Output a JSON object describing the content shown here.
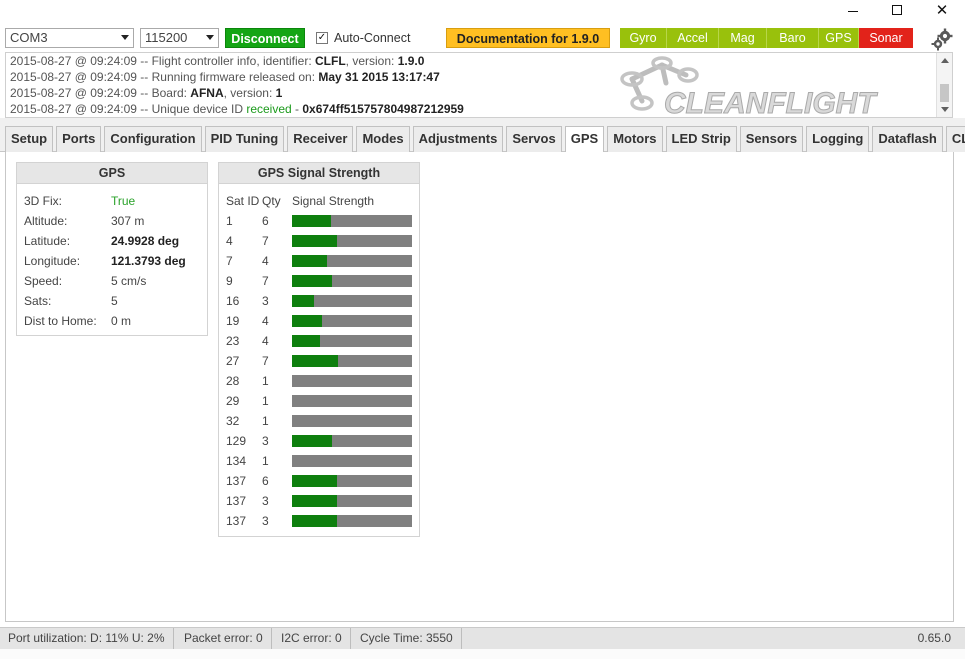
{
  "window": {
    "minimize_glyph": "—",
    "close_glyph": "✕"
  },
  "header": {
    "port": "COM3",
    "baud": "115200",
    "disconnect_label": "Disconnect",
    "auto_connect_label": "Auto-Connect",
    "auto_connect_checked": true,
    "documentation_label": "Documentation for 1.9.0",
    "sensors": [
      {
        "label": "Gyro",
        "state": "on"
      },
      {
        "label": "Accel",
        "state": "on"
      },
      {
        "label": "Mag",
        "state": "on"
      },
      {
        "label": "Baro",
        "state": "on"
      },
      {
        "label": "GPS",
        "state": "on"
      },
      {
        "label": "Sonar",
        "state": "off"
      }
    ],
    "settings_icon": "gear-icon"
  },
  "log": {
    "lines": [
      {
        "prefix": "2015-08-27 @ 09:24:09 -- Flight controller info, identifier: ",
        "b1": "CLFL",
        "mid": ", version: ",
        "b2": "1.9.0"
      },
      {
        "prefix": "2015-08-27 @ 09:24:09 -- Running firmware released on: ",
        "b1": "May 31 2015 13:17:47"
      },
      {
        "prefix": "2015-08-27 @ 09:24:09 -- Board: ",
        "b1": "AFNA",
        "mid": ", version: ",
        "b2": "1"
      },
      {
        "prefix": "2015-08-27 @ 09:24:09 -- Unique device ID ",
        "green": "received",
        "mid": " - ",
        "b2": "0x674ff515757804987212959"
      }
    ],
    "logo_text": "CLEANFLIGHT"
  },
  "tabs": [
    "Setup",
    "Ports",
    "Configuration",
    "PID Tuning",
    "Receiver",
    "Modes",
    "Adjustments",
    "Servos",
    "GPS",
    "Motors",
    "LED Strip",
    "Sensors",
    "Logging",
    "Dataflash",
    "CLI"
  ],
  "active_tab": "GPS",
  "gps": {
    "title": "GPS",
    "fields": [
      {
        "key": "3D Fix:",
        "value": "True",
        "style": "green"
      },
      {
        "key": "Altitude:",
        "value": "307 m",
        "style": ""
      },
      {
        "key": "Latitude:",
        "value": "24.9928 deg",
        "style": "bold"
      },
      {
        "key": "Longitude:",
        "value": "121.3793 deg",
        "style": "bold"
      },
      {
        "key": "Speed:",
        "value": "5 cm/s",
        "style": ""
      },
      {
        "key": "Sats:",
        "value": "5",
        "style": ""
      },
      {
        "key": "Dist to Home:",
        "value": "0 m",
        "style": ""
      }
    ]
  },
  "signal": {
    "title": "GPS Signal Strength",
    "col_sat": "Sat ID",
    "col_qty": "Qty",
    "col_strength": "Signal Strength",
    "rows": [
      {
        "sat": "1",
        "qty": "6",
        "strength": 32
      },
      {
        "sat": "4",
        "qty": "7",
        "strength": 37
      },
      {
        "sat": "7",
        "qty": "4",
        "strength": 29
      },
      {
        "sat": "9",
        "qty": "7",
        "strength": 33
      },
      {
        "sat": "16",
        "qty": "3",
        "strength": 18
      },
      {
        "sat": "19",
        "qty": "4",
        "strength": 25
      },
      {
        "sat": "23",
        "qty": "4",
        "strength": 23
      },
      {
        "sat": "27",
        "qty": "7",
        "strength": 38
      },
      {
        "sat": "28",
        "qty": "1",
        "strength": 0
      },
      {
        "sat": "29",
        "qty": "1",
        "strength": 0
      },
      {
        "sat": "32",
        "qty": "1",
        "strength": 0
      },
      {
        "sat": "129",
        "qty": "3",
        "strength": 33
      },
      {
        "sat": "134",
        "qty": "1",
        "strength": 0
      },
      {
        "sat": "137",
        "qty": "6",
        "strength": 37
      },
      {
        "sat": "137",
        "qty": "3",
        "strength": 37
      },
      {
        "sat": "137",
        "qty": "3",
        "strength": 37
      }
    ]
  },
  "status": {
    "port_util": "Port utilization: D: 11% U: 2%",
    "packet_error": "Packet error: 0",
    "i2c_error": "I2C error: 0",
    "cycle_time": "Cycle Time: 3550",
    "version": "0.65.0"
  },
  "colors": {
    "connect_green": "#14a514",
    "docs_orange": "#ffbf22",
    "sensor_on": "#99c10c",
    "sensor_off": "#e2231a",
    "signal_fill": "#0e7f0e",
    "signal_empty": "#808080"
  }
}
